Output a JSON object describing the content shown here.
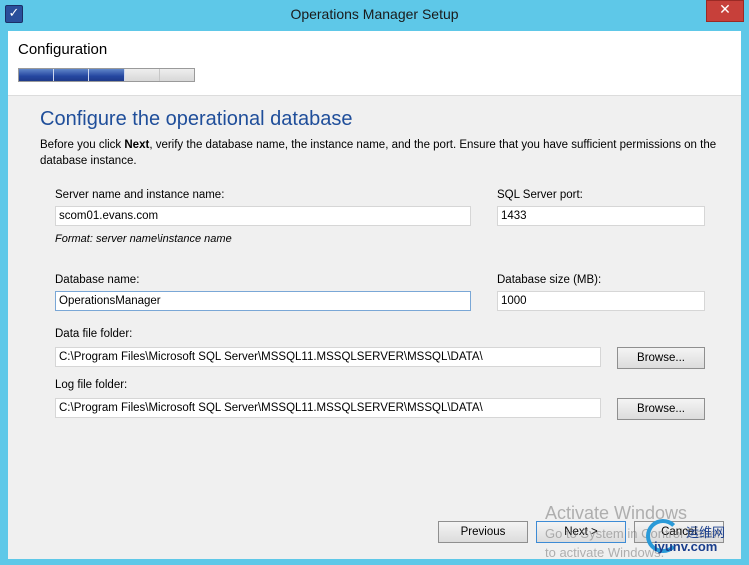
{
  "window": {
    "title": "Operations Manager Setup",
    "close_glyph": "✕",
    "app_icon": "setup-app-icon"
  },
  "header": {
    "section": "Configuration",
    "progress": {
      "total_steps": 5,
      "completed_steps": 3
    }
  },
  "page": {
    "heading": "Configure the operational database",
    "description_prefix": "Before you click ",
    "description_bold": "Next",
    "description_suffix": ", verify the database name, the instance name, and the port. Ensure that you have sufficient permissions on the database instance."
  },
  "form": {
    "server_label": "Server name and instance name:",
    "server_value": "scom01.evans.com",
    "server_format_note": "Format: server name\\instance name",
    "port_label": "SQL Server port:",
    "port_value": "1433",
    "db_name_label": "Database name:",
    "db_name_value": "OperationsManager",
    "db_size_label": "Database size (MB):",
    "db_size_value": "1000",
    "data_folder_label": "Data file folder:",
    "data_folder_value": "C:\\Program Files\\Microsoft SQL Server\\MSSQL11.MSSQLSERVER\\MSSQL\\DATA\\",
    "data_browse_label": "Browse...",
    "log_folder_label": "Log file folder:",
    "log_folder_value": "C:\\Program Files\\Microsoft SQL Server\\MSSQL11.MSSQLSERVER\\MSSQL\\DATA\\",
    "log_browse_label": "Browse..."
  },
  "footer": {
    "previous_label": "Previous",
    "next_label": "Next >",
    "cancel_label": "Cancel"
  },
  "overlay": {
    "activation_title": "Activate Windows",
    "activation_line1": "Go to System in Control Panel",
    "activation_line2": "to activate Windows.",
    "site_logo_text": "iyunv.com",
    "site_logo_cn": "运维网"
  },
  "colors": {
    "titlebar": "#5ec8e8",
    "heading": "#1f4e9a",
    "progress_fill": "#2547a0",
    "close": "#c7403a"
  }
}
